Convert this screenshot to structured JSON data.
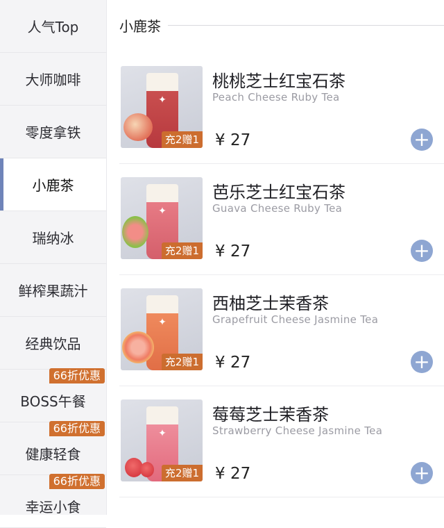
{
  "sidebar": {
    "items": [
      {
        "label": "人气Top"
      },
      {
        "label": "大师咖啡"
      },
      {
        "label": "零度拿铁"
      },
      {
        "label": "小鹿茶"
      },
      {
        "label": "瑞纳冰"
      },
      {
        "label": "鲜榨果蔬汁"
      },
      {
        "label": "经典饮品"
      },
      {
        "label": "BOSS午餐",
        "badge": "66折优惠"
      },
      {
        "label": "健康轻食",
        "badge": "66折优惠"
      },
      {
        "label": "幸运小食",
        "badge": "66折优惠"
      }
    ],
    "active_index": 3
  },
  "section": {
    "title": "小鹿茶"
  },
  "products": [
    {
      "name_cn": "桃桃芝士红宝石茶",
      "name_en": "Peach Cheese Ruby Tea",
      "price": "¥ 27",
      "promo": "充2赠1"
    },
    {
      "name_cn": "芭乐芝士红宝石茶",
      "name_en": "Guava Cheese Ruby Tea",
      "price": "¥ 27",
      "promo": "充2赠1"
    },
    {
      "name_cn": "西柚芝士茉香茶",
      "name_en": "Grapefruit Cheese Jasmine Tea",
      "price": "¥ 27",
      "promo": "充2赠1"
    },
    {
      "name_cn": "莓莓芝士茉香茶",
      "name_en": "Strawberry Cheese Jasmine Tea",
      "price": "¥ 27",
      "promo": "充2赠1"
    }
  ],
  "icons": {
    "add": "plus-icon",
    "product_image": "drink-image"
  },
  "colors": {
    "accent": "#8ea6d2",
    "promo": "#cc6d2f",
    "active_bar": "#6f84b9"
  }
}
